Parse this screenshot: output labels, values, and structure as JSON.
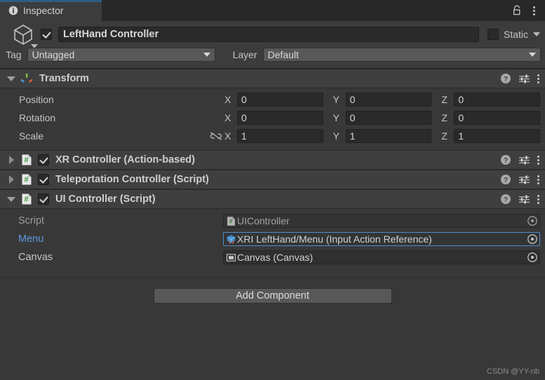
{
  "window": {
    "tab_label": "Inspector",
    "tab_icon": "info-icon",
    "lock_icon": "lock-icon",
    "menu_icon": "kebab-menu-icon",
    "accent_color": "#2c5d87"
  },
  "object_header": {
    "prefab_icon": "cube-icon",
    "enabled": true,
    "name_value": "LeftHand Controller",
    "static_label": "Static",
    "static_checked": false,
    "tag_label": "Tag",
    "tag_value": "Untagged",
    "layer_label": "Layer",
    "layer_value": "Default"
  },
  "components": [
    {
      "name": "transform",
      "icon": "transform-axis-icon",
      "title": "Transform",
      "expanded": true,
      "has_enable_toggle": false,
      "actions": [
        "help-icon",
        "preset-icon",
        "kebab-menu-icon"
      ],
      "rows": [
        {
          "label": "Position",
          "linked": null,
          "x": "0",
          "y": "0",
          "z": "0"
        },
        {
          "label": "Rotation",
          "linked": null,
          "x": "0",
          "y": "0",
          "z": "0"
        },
        {
          "label": "Scale",
          "linked": "link-broken-icon",
          "x": "1",
          "y": "1",
          "z": "1"
        }
      ],
      "axis_labels": {
        "x": "X",
        "y": "Y",
        "z": "Z"
      }
    },
    {
      "name": "xr-controller",
      "icon": "cs-script-icon",
      "title": "XR Controller (Action-based)",
      "expanded": false,
      "has_enable_toggle": true,
      "enabled": true,
      "actions": [
        "help-icon",
        "preset-icon",
        "kebab-menu-icon"
      ]
    },
    {
      "name": "teleportation-controller",
      "icon": "cs-script-icon",
      "title": "Teleportation Controller (Script)",
      "expanded": false,
      "has_enable_toggle": true,
      "enabled": true,
      "actions": [
        "help-icon",
        "preset-icon",
        "kebab-menu-icon"
      ]
    },
    {
      "name": "ui-controller",
      "icon": "cs-script-icon",
      "title": "UI Controller (Script)",
      "expanded": true,
      "has_enable_toggle": true,
      "enabled": true,
      "actions": [
        "help-icon",
        "preset-icon",
        "kebab-menu-icon"
      ],
      "properties": [
        {
          "label": "Script",
          "label_style": "dim",
          "icon": "cs-script-icon",
          "value": "UIController",
          "value_style": "dim",
          "field_state": "disabled",
          "picker": "object-picker-icon"
        },
        {
          "label": "Menu",
          "label_style": "highlight",
          "icon": "input-action-reference-icon",
          "value": "XRI LeftHand/Menu (Input Action Reference)",
          "value_style": "normal",
          "field_state": "selected",
          "picker": "object-picker-icon"
        },
        {
          "label": "Canvas",
          "label_style": "normal",
          "icon": "canvas-icon",
          "value": "Canvas (Canvas)",
          "value_style": "normal",
          "field_state": "normal",
          "picker": "object-picker-icon"
        }
      ]
    }
  ],
  "footer": {
    "add_component_label": "Add Component",
    "watermark": "CSDN @YY-nb"
  }
}
